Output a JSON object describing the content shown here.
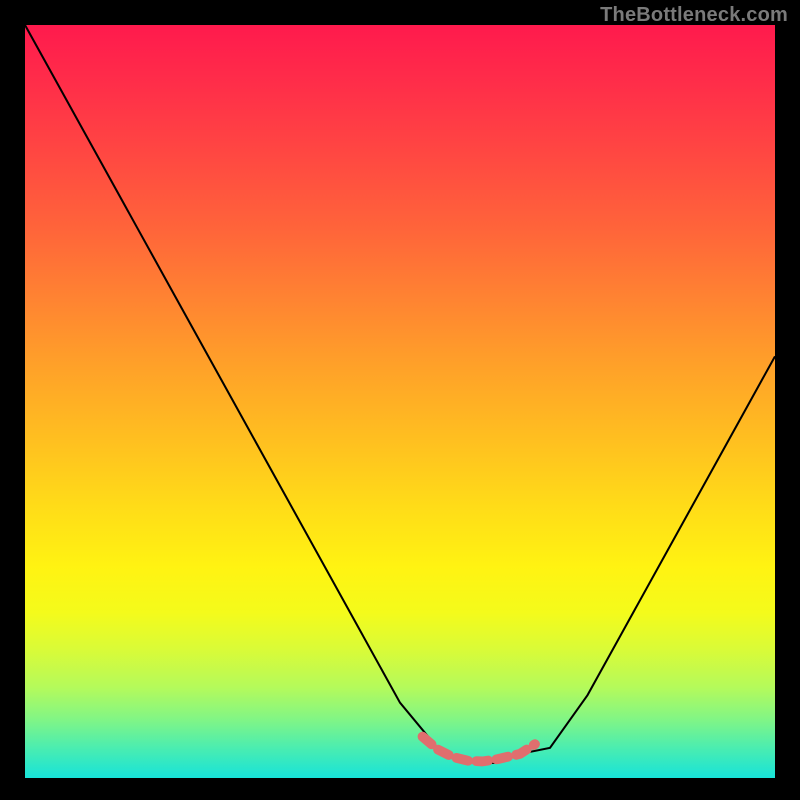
{
  "watermark": "TheBottleneck.com",
  "chart_data": {
    "type": "line",
    "title": "",
    "xlabel": "",
    "ylabel": "",
    "xlim": [
      0,
      100
    ],
    "ylim": [
      0,
      100
    ],
    "grid": false,
    "legend": false,
    "series": [
      {
        "name": "main-curve",
        "color": "#000000",
        "stroke_width": 2,
        "x": [
          0,
          5,
          10,
          15,
          20,
          25,
          30,
          35,
          40,
          45,
          50,
          55,
          57,
          60,
          63,
          65,
          70,
          75,
          80,
          85,
          90,
          95,
          100
        ],
        "y": [
          100,
          91,
          82,
          73,
          64,
          55,
          46,
          37,
          28,
          19,
          10,
          4,
          3,
          2,
          2,
          3,
          4,
          11,
          20,
          29,
          38,
          47,
          56
        ]
      },
      {
        "name": "marker-curve",
        "color": "#e06e6e",
        "stroke_width": 10,
        "x": [
          53,
          55,
          57,
          59,
          61,
          63,
          66,
          68
        ],
        "y": [
          5.5,
          3.8,
          2.8,
          2.3,
          2.2,
          2.5,
          3.2,
          4.5
        ]
      }
    ],
    "background_gradient": {
      "direction": "vertical",
      "stops": [
        {
          "pos": 0.0,
          "color": "#ff1a4d"
        },
        {
          "pos": 0.27,
          "color": "#ff643a"
        },
        {
          "pos": 0.55,
          "color": "#ffbf20"
        },
        {
          "pos": 0.78,
          "color": "#f4fb1b"
        },
        {
          "pos": 1.0,
          "color": "#17e3d9"
        }
      ]
    }
  }
}
